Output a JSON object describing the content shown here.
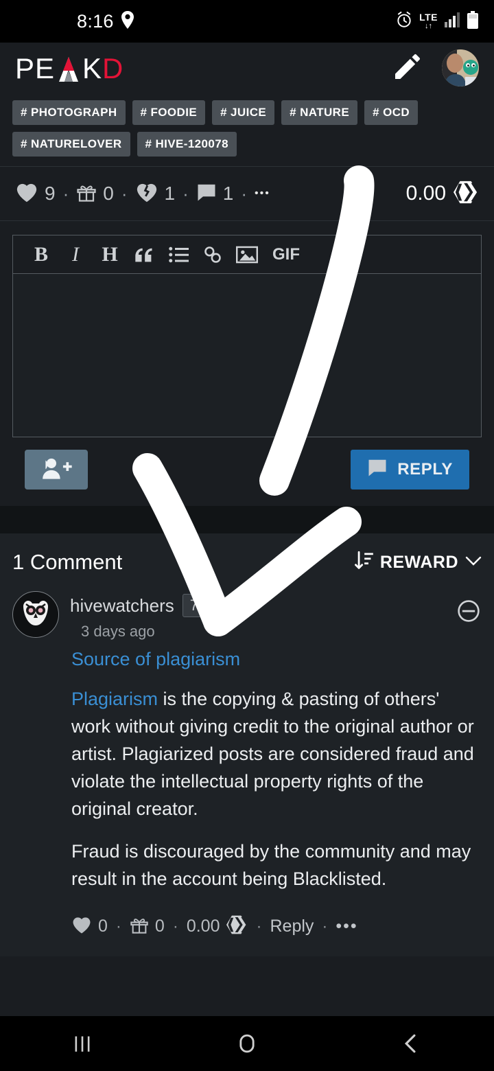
{
  "statusbar": {
    "time": "8:16",
    "location_icon": "location-pin-icon",
    "alarm_icon": "alarm-clock-icon",
    "network_label": "LTE",
    "network_arrows": "↓↑",
    "signal_icon": "signal-bars-icon",
    "battery_icon": "battery-icon"
  },
  "header": {
    "brand_part1": "PE",
    "brand_part2": "K",
    "brand_part3": "D",
    "edit_icon": "pencil-icon",
    "avatar": "user-avatar"
  },
  "post": {
    "tags": [
      "# PHOTOGRAPH",
      "# FOODIE",
      "# JUICE",
      "# NATURE",
      "# OCD",
      "# NATURELOVER",
      "# HIVE-120078"
    ],
    "stats": {
      "votes": "9",
      "gifts": "0",
      "downvotes": "1",
      "comments": "1",
      "more": "•••",
      "payout": "0.00",
      "payout_icon": "hive-logo-icon"
    }
  },
  "editor": {
    "toolbar": {
      "bold": "B",
      "italic": "I",
      "heading": "H",
      "quote": "quote-icon",
      "list": "bullet-list-icon",
      "link": "link-icon",
      "image": "image-icon",
      "gif": "GIF"
    },
    "textarea_value": "",
    "textarea_placeholder": "",
    "add_user_icon": "add-user-icon",
    "reply_label": "REPLY",
    "reply_icon": "comment-icon"
  },
  "comments_section": {
    "title": "1 Comment",
    "sort_label": "REWARD",
    "sort_icon": "sort-descending-icon",
    "chevron_icon": "chevron-down-icon",
    "items": [
      {
        "avatar": "owl-avatar",
        "author": "hivewatchers",
        "reputation": "77",
        "timestamp": "3 days ago",
        "collapse_icon": "collapse-minus-icon",
        "link_title": "Source of plagiarism",
        "paragraph1_link": "Plagiarism",
        "paragraph1_rest": " is the copying & pasting of others' work without giving credit to the original author or artist. Plagiarized posts are considered fraud and violate the intellectual property rights of the original creator.",
        "paragraph2": "Fraud is discouraged by the community and may result in the account being Blacklisted.",
        "actions": {
          "votes": "0",
          "gifts": "0",
          "payout": "0.00",
          "payout_icon": "hive-logo-icon",
          "reply_label": "Reply",
          "more": "•••"
        }
      }
    ]
  },
  "navbar": {
    "recents_icon": "recent-apps-icon",
    "home_icon": "home-icon",
    "back_icon": "back-icon"
  },
  "colors": {
    "accent_blue": "#1f6eaf",
    "link_blue": "#3a8fd4",
    "brand_red": "#e31337",
    "background": "#1a1d21",
    "tag_bg": "#4a5056"
  }
}
